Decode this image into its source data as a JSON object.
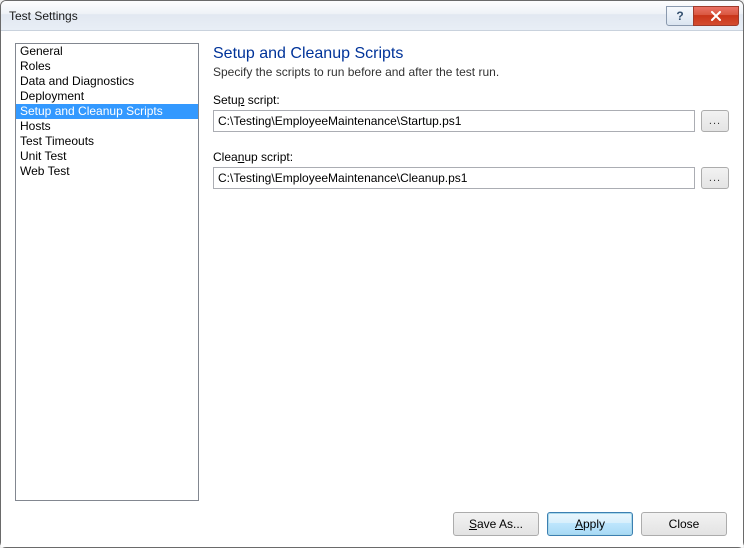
{
  "window": {
    "title": "Test Settings"
  },
  "titlebar": {
    "help_glyph": "?"
  },
  "sidebar": {
    "items": [
      {
        "label": "General",
        "selected": false
      },
      {
        "label": "Roles",
        "selected": false
      },
      {
        "label": "Data and Diagnostics",
        "selected": false
      },
      {
        "label": "Deployment",
        "selected": false
      },
      {
        "label": "Setup and Cleanup Scripts",
        "selected": true
      },
      {
        "label": "Hosts",
        "selected": false
      },
      {
        "label": "Test Timeouts",
        "selected": false
      },
      {
        "label": "Unit Test",
        "selected": false
      },
      {
        "label": "Web Test",
        "selected": false
      }
    ]
  },
  "main": {
    "heading": "Setup and Cleanup Scripts",
    "subtitle": "Specify the scripts to run before and after the test run.",
    "setup": {
      "label_pre": "Setu",
      "label_u": "p",
      "label_post": " script:",
      "value": "C:\\Testing\\EmployeeMaintenance\\Startup.ps1",
      "browse": "..."
    },
    "cleanup": {
      "label_pre": "Clea",
      "label_u": "n",
      "label_post": "up script:",
      "value": "C:\\Testing\\EmployeeMaintenance\\Cleanup.ps1",
      "browse": "..."
    }
  },
  "footer": {
    "save_as_pre": "",
    "save_as_u": "S",
    "save_as_post": "ave As...",
    "apply_pre": "",
    "apply_u": "A",
    "apply_post": "pply",
    "close": "Close"
  }
}
